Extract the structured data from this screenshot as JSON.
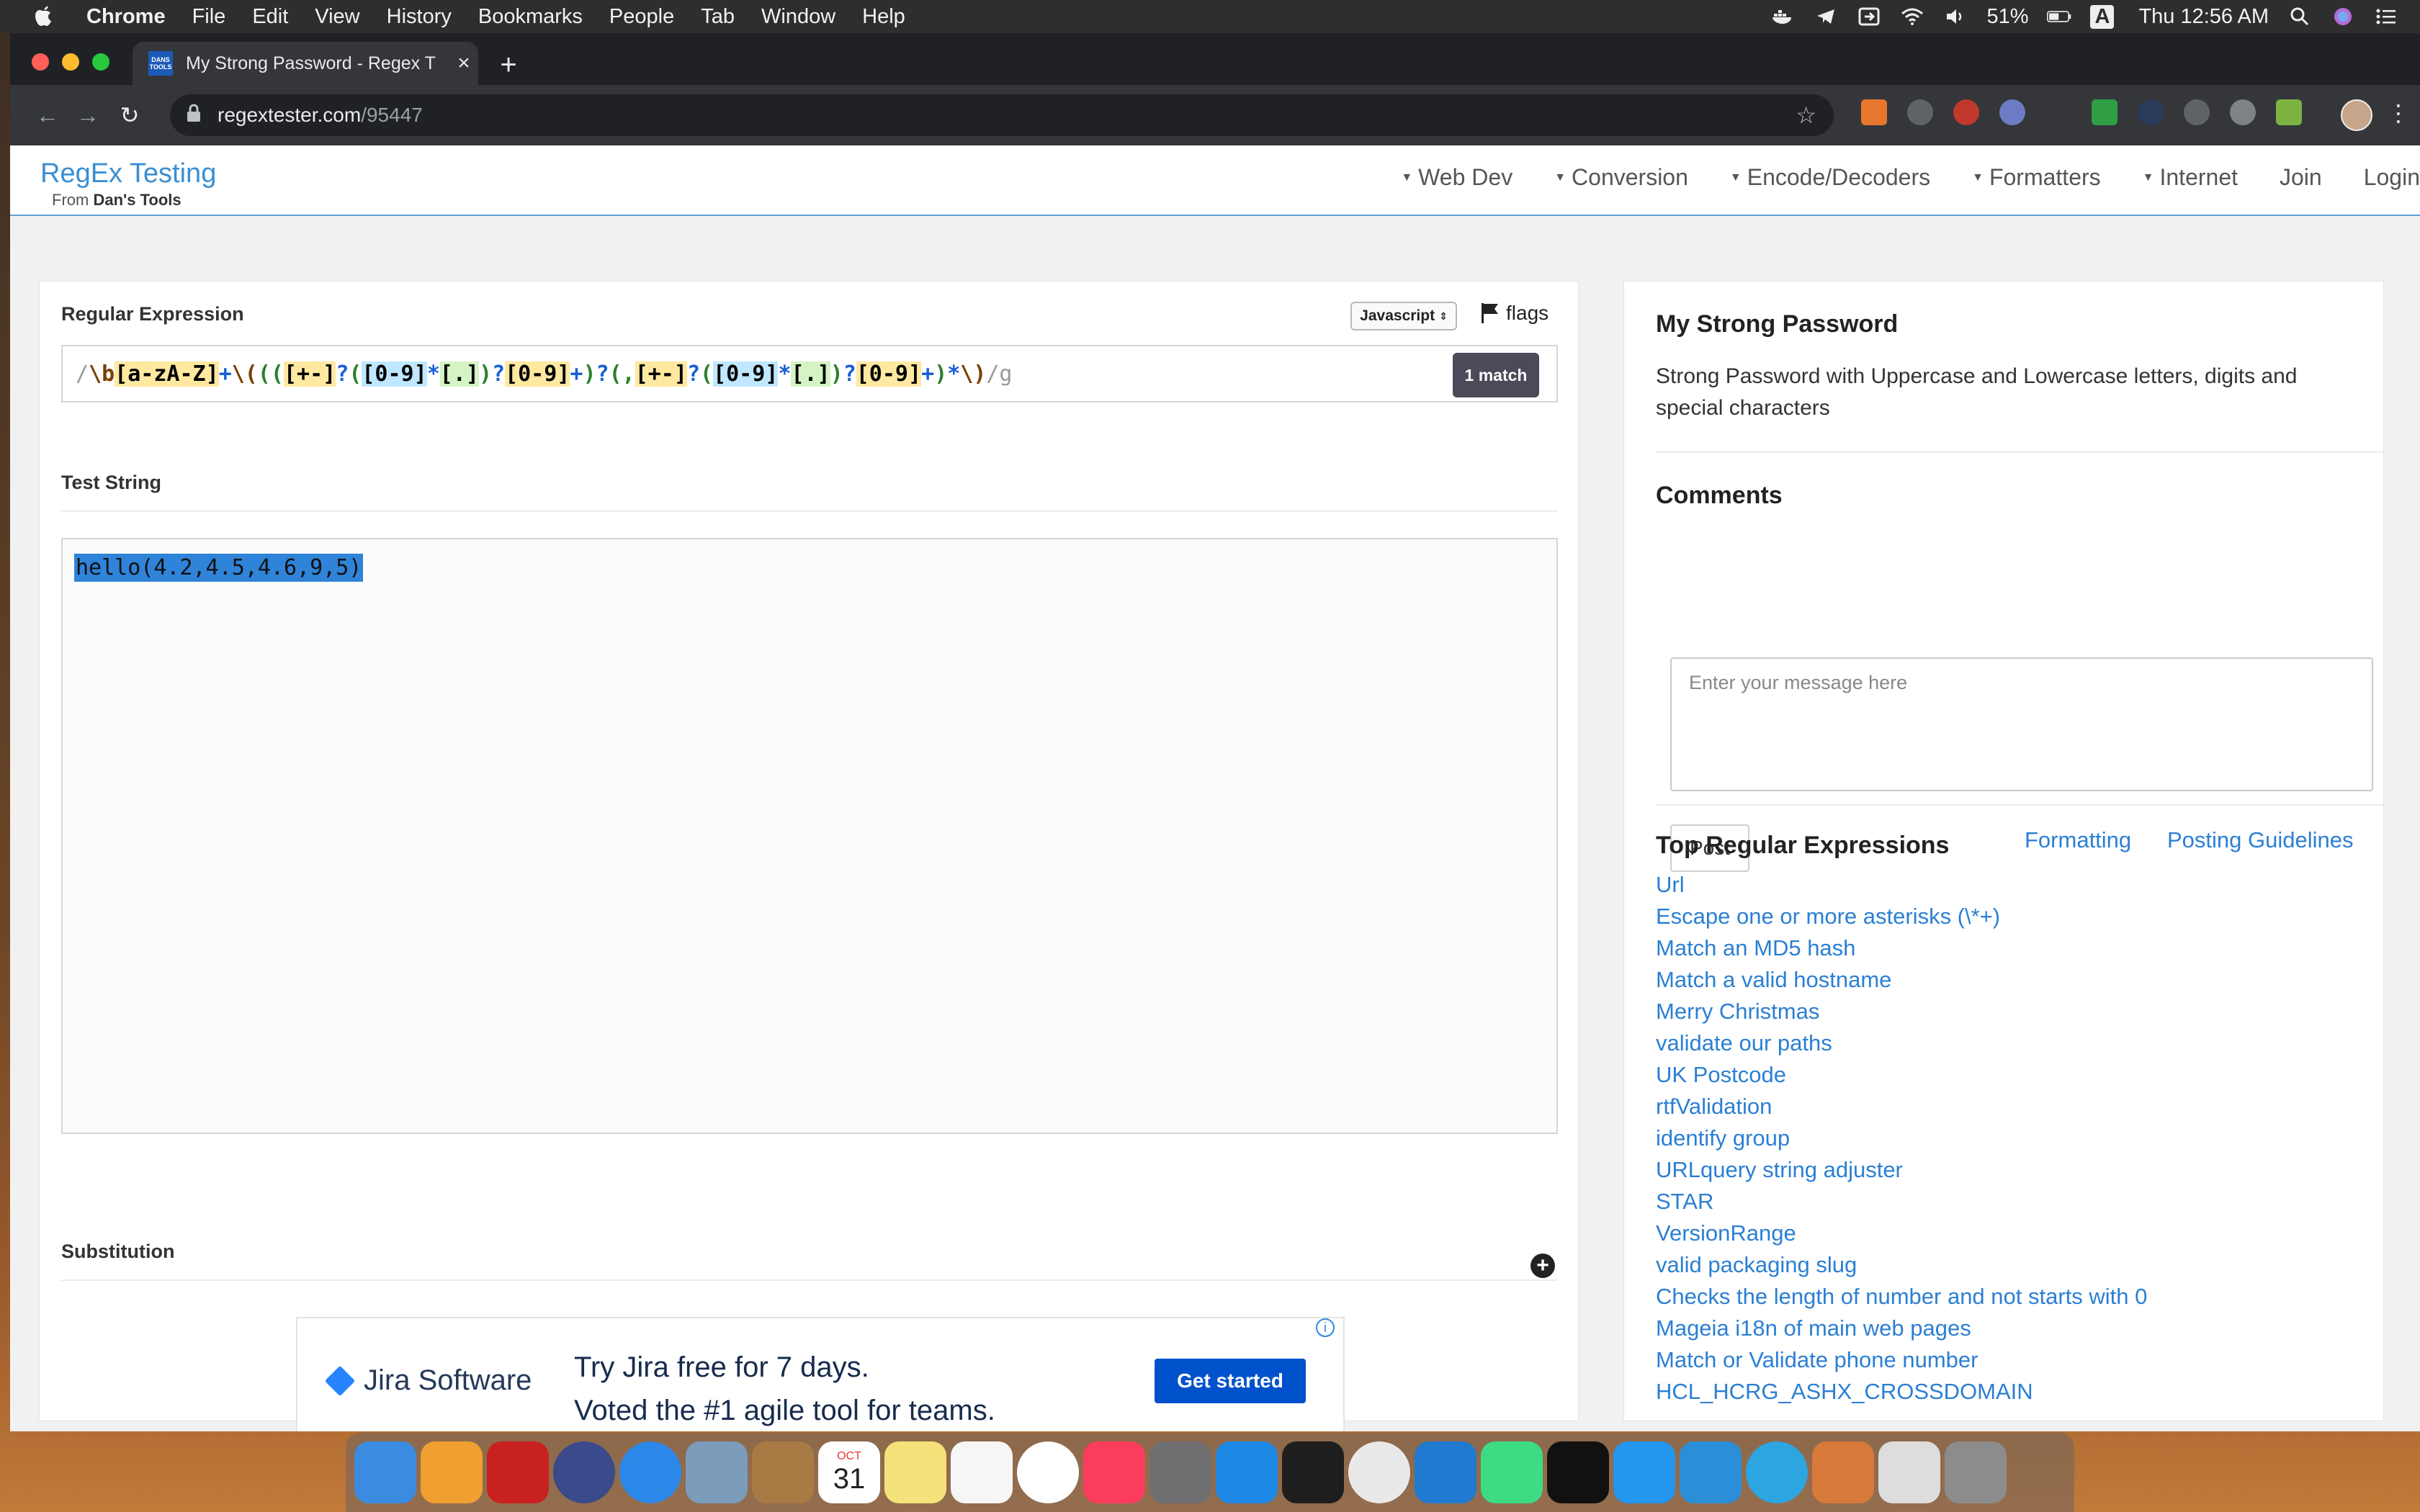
{
  "menubar": {
    "app_name": "Chrome",
    "items": [
      "File",
      "Edit",
      "View",
      "History",
      "Bookmarks",
      "People",
      "Tab",
      "Window",
      "Help"
    ],
    "battery": "51%",
    "input_source": "A",
    "clock": "Thu 12:56 AM"
  },
  "browser": {
    "tab_title": "My Strong Password - Regex T",
    "favicon_text": "DANS TOOLS",
    "url_host": "regextester.com",
    "url_path": "/95447"
  },
  "site": {
    "brand_title": "RegEx Testing",
    "brand_sub_prefix": "From ",
    "brand_sub_name": "Dan's Tools",
    "nav": [
      "Web Dev",
      "Conversion",
      "Encode/Decoders",
      "Formatters",
      "Internet",
      "Join",
      "Login"
    ]
  },
  "regex_panel": {
    "label": "Regular Expression",
    "flavor": "Javascript",
    "flags_label": "flags",
    "match_label": "1 match",
    "expression": "/\\b[a-zA-Z]+\\(([+-]?([0-9]*[.])?[0-9]+)?(,[+-]?([0-9]*[.])?[0-9]+)*\\)/g"
  },
  "test_panel": {
    "label": "Test String",
    "value": "hello(4.2,4.5,4.6,9,5)"
  },
  "substitution_panel": {
    "label": "Substitution"
  },
  "ad": {
    "brand": "Jira Software",
    "line1": "Try Jira free for 7 days.",
    "line2": "Voted the #1 agile tool for teams.",
    "cta": "Get started",
    "info": "i"
  },
  "sidebar": {
    "title": "My Strong Password",
    "description": "Strong Password with Uppercase and Lowercase letters, digits and special characters",
    "comments_title": "Comments",
    "comment_placeholder": "Enter your message here",
    "post_label": "Post",
    "formatting_link": "Formatting",
    "guidelines_link": "Posting Guidelines",
    "top_title": "Top Regular Expressions",
    "top_items": [
      "Url",
      "Escape one or more asterisks (\\*+)",
      "Match an MD5 hash",
      "Match a valid hostname",
      "Merry Christmas",
      "validate our paths",
      "UK Postcode",
      "rtfValidation",
      "identify group",
      "URLquery string adjuster",
      "STAR",
      "VersionRange",
      "valid packaging slug",
      "Checks the length of number and not starts with 0",
      "Mageia i18n of main web pages",
      "Match or Validate phone number",
      "HCL_HCRG_ASHX_CROSSDOMAIN"
    ]
  },
  "colors": {
    "accent": "#2b7fd3",
    "match_button": "#4a4a58",
    "selection": "#2f83d8",
    "ad_cta": "#0052cc"
  },
  "dock": {
    "calendar_month": "OCT",
    "calendar_day": "31"
  }
}
